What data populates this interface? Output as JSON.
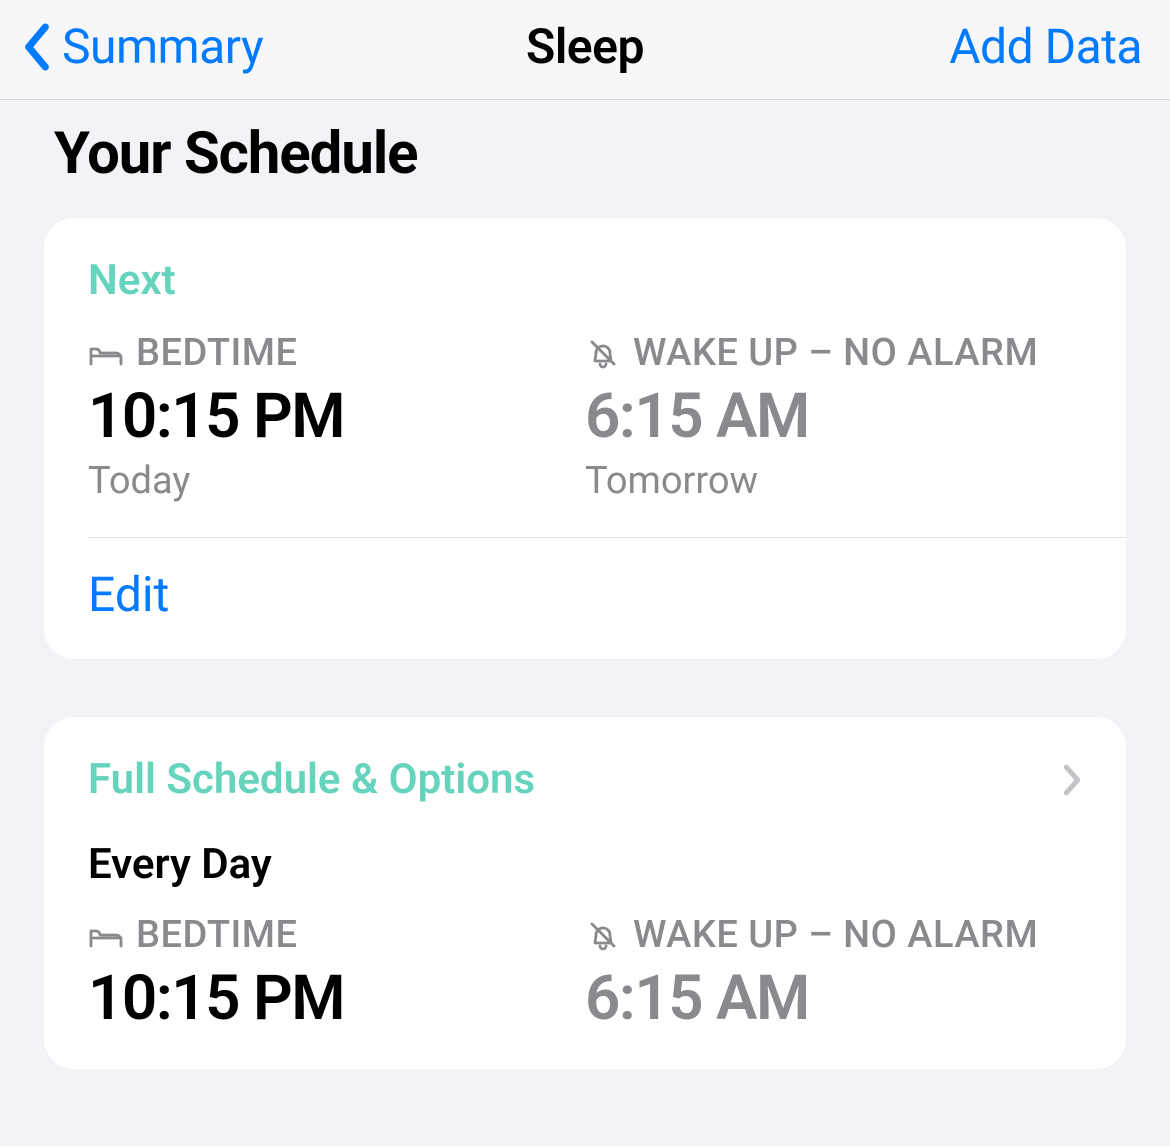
{
  "nav": {
    "back_label": "Summary",
    "title": "Sleep",
    "add_label": "Add Data"
  },
  "section_heading": "Your Schedule",
  "next_card": {
    "label": "Next",
    "bedtime": {
      "heading": "BEDTIME",
      "time": "10:15 PM",
      "day": "Today"
    },
    "wakeup": {
      "heading": "WAKE UP – NO ALARM",
      "time": "6:15 AM",
      "day": "Tomorrow"
    },
    "edit_label": "Edit"
  },
  "full_card": {
    "label": "Full Schedule & Options",
    "frequency": "Every Day",
    "bedtime": {
      "heading": "BEDTIME",
      "time": "10:15 PM"
    },
    "wakeup": {
      "heading": "WAKE UP – NO ALARM",
      "time": "6:15 AM"
    }
  },
  "colors": {
    "accent_blue": "#007aff",
    "accent_teal": "#66d4bd",
    "bg": "#f2f2f7"
  }
}
